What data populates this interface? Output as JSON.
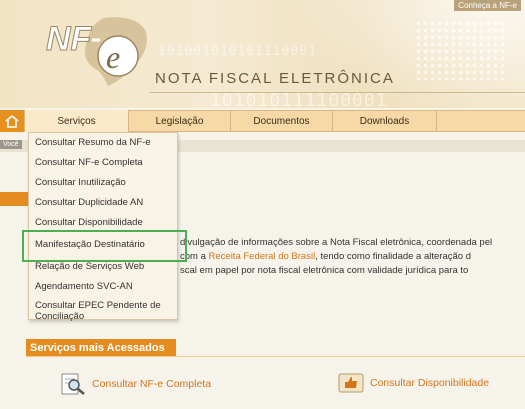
{
  "header": {
    "logo_text": "NF-e",
    "site_title": "NOTA FISCAL ELETRÔNICA",
    "binary_1": "101001010101110001",
    "binary_2": "101010111100001",
    "top_link": "Conheça a NF-e"
  },
  "nav": {
    "items": [
      {
        "label": "Serviços"
      },
      {
        "label": "Legislação"
      },
      {
        "label": "Documentos"
      },
      {
        "label": "Downloads"
      }
    ]
  },
  "breadcrumb": "Você",
  "dropdown": {
    "items": [
      {
        "label": "Consultar Resumo da NF-e"
      },
      {
        "label": "Consultar NF-e Completa"
      },
      {
        "label": "Consultar Inutilização"
      },
      {
        "label": "Consultar Duplicidade AN"
      },
      {
        "label": "Consultar Disponibilidade"
      },
      {
        "label": "Manifestação Destinatário"
      },
      {
        "label": "Relação de Serviços Web"
      },
      {
        "label": "Agendamento SVC-AN"
      },
      {
        "label": "Consultar EPEC Pendente de Conciliação"
      }
    ]
  },
  "body": {
    "line1": "divulgação de informações sobre a Nota Fiscal eletrônica, coordenada pel",
    "line2_prefix": "com a ",
    "line2_link": "Receita Federal do Brasil",
    "line2_suffix": ", tendo como finalidade a alteração d",
    "line3": "scal em papel por nota fiscal eletrônica com validade jurídica para to"
  },
  "services": {
    "title": "Serviços mais Acessados",
    "link1": "Consultar NF-e Completa",
    "link2": "Consultar Disponibilidade"
  },
  "colors": {
    "accent": "#e48c1f",
    "highlight": "#4caf50",
    "link": "#d2751b"
  }
}
